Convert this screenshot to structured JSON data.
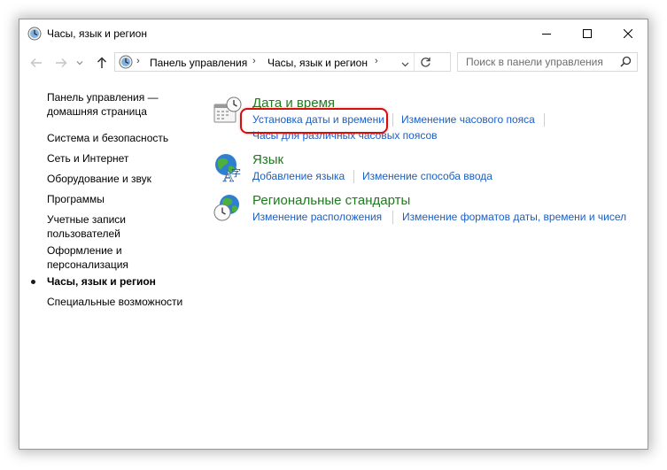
{
  "window": {
    "title": "Часы, язык и регион",
    "controls": {
      "minimize": "minimize",
      "maximize": "maximize",
      "close": "close"
    }
  },
  "address_bar": {
    "breadcrumbs": [
      "Панель управления",
      "Часы, язык и регион"
    ]
  },
  "search": {
    "placeholder": "Поиск в панели управления"
  },
  "sidebar": {
    "items": [
      {
        "label": "Панель управления —\nдомашняя страница"
      },
      {
        "label": "Система и безопасность"
      },
      {
        "label": "Сеть и Интернет"
      },
      {
        "label": "Оборудование и звук"
      },
      {
        "label": "Программы"
      },
      {
        "label": "Учетные записи\nпользователей"
      },
      {
        "label": "Оформление и\nперсонализация"
      },
      {
        "label": "Часы, язык и регион",
        "current": true
      },
      {
        "label": "Специальные возможности"
      }
    ]
  },
  "categories": [
    {
      "title": "Дата и время",
      "icon": "calendar-clock-icon",
      "links": [
        "Установка даты и времени",
        "Изменение часового пояса",
        "Часы для различных часовых поясов"
      ]
    },
    {
      "title": "Язык",
      "icon": "globe-language-icon",
      "links": [
        "Добавление языка",
        "Изменение способа ввода"
      ]
    },
    {
      "title": "Региональные стандарты",
      "icon": "globe-clock-icon",
      "links": [
        "Изменение расположения",
        "Изменение форматов даты, времени и чисел"
      ]
    }
  ],
  "highlight": {
    "target": "Установка даты и времени",
    "color": "#d40d0d"
  },
  "colors": {
    "link": "#1a5ec4",
    "category_title": "#1e7a1e",
    "window_border": "#7a9cc6"
  }
}
